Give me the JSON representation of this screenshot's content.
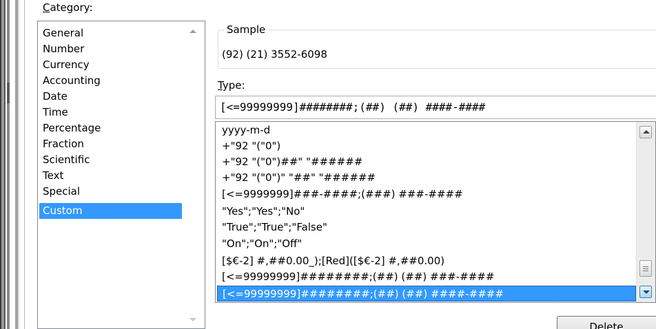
{
  "category": {
    "label_first": "C",
    "label_rest": "ategory:",
    "items": [
      {
        "label": "General",
        "selected": false
      },
      {
        "label": "Number",
        "selected": false
      },
      {
        "label": "Currency",
        "selected": false
      },
      {
        "label": "Accounting",
        "selected": false
      },
      {
        "label": "Date",
        "selected": false
      },
      {
        "label": "Time",
        "selected": false
      },
      {
        "label": "Percentage",
        "selected": false
      },
      {
        "label": "Fraction",
        "selected": false
      },
      {
        "label": "Scientific",
        "selected": false
      },
      {
        "label": "Text",
        "selected": false
      },
      {
        "label": "Special",
        "selected": false
      },
      {
        "label": "Custom",
        "selected": true
      }
    ]
  },
  "sample": {
    "legend": "Sample",
    "value": "(92) (21) 3552-6098"
  },
  "type": {
    "label_first": "T",
    "label_rest": "ype:",
    "value": "[<=99999999]########;(##) (##) ####-####",
    "formats": [
      {
        "label": "yyyy-m-d",
        "selected": false
      },
      {
        "label": "+\"92 \"(\"0\")",
        "selected": false
      },
      {
        "label": "+\"92 \"(\"0\")##\" \"######",
        "selected": false
      },
      {
        "label": "+\"92 \"(\"0\")\" \"##\" \"######",
        "selected": false
      },
      {
        "label": "[<=9999999]###-####;(###) ###-####",
        "selected": false
      },
      {
        "label": "\"Yes\";\"Yes\";\"No\"",
        "selected": false
      },
      {
        "label": "\"True\";\"True\";\"False\"",
        "selected": false
      },
      {
        "label": "\"On\";\"On\";\"Off\"",
        "selected": false
      },
      {
        "label": "[$€-2] #,##0.00_);[Red]([$€-2] #,##0.00)",
        "selected": false
      },
      {
        "label": "[<=99999999]########;(##) (##) ###-####",
        "selected": false
      },
      {
        "label": "[<=99999999]########;(##) (##) ####-####",
        "selected": true
      }
    ]
  },
  "buttons": {
    "delete": "Delete"
  },
  "colors": {
    "selection": "#3399ff",
    "list_border": "#828790"
  }
}
